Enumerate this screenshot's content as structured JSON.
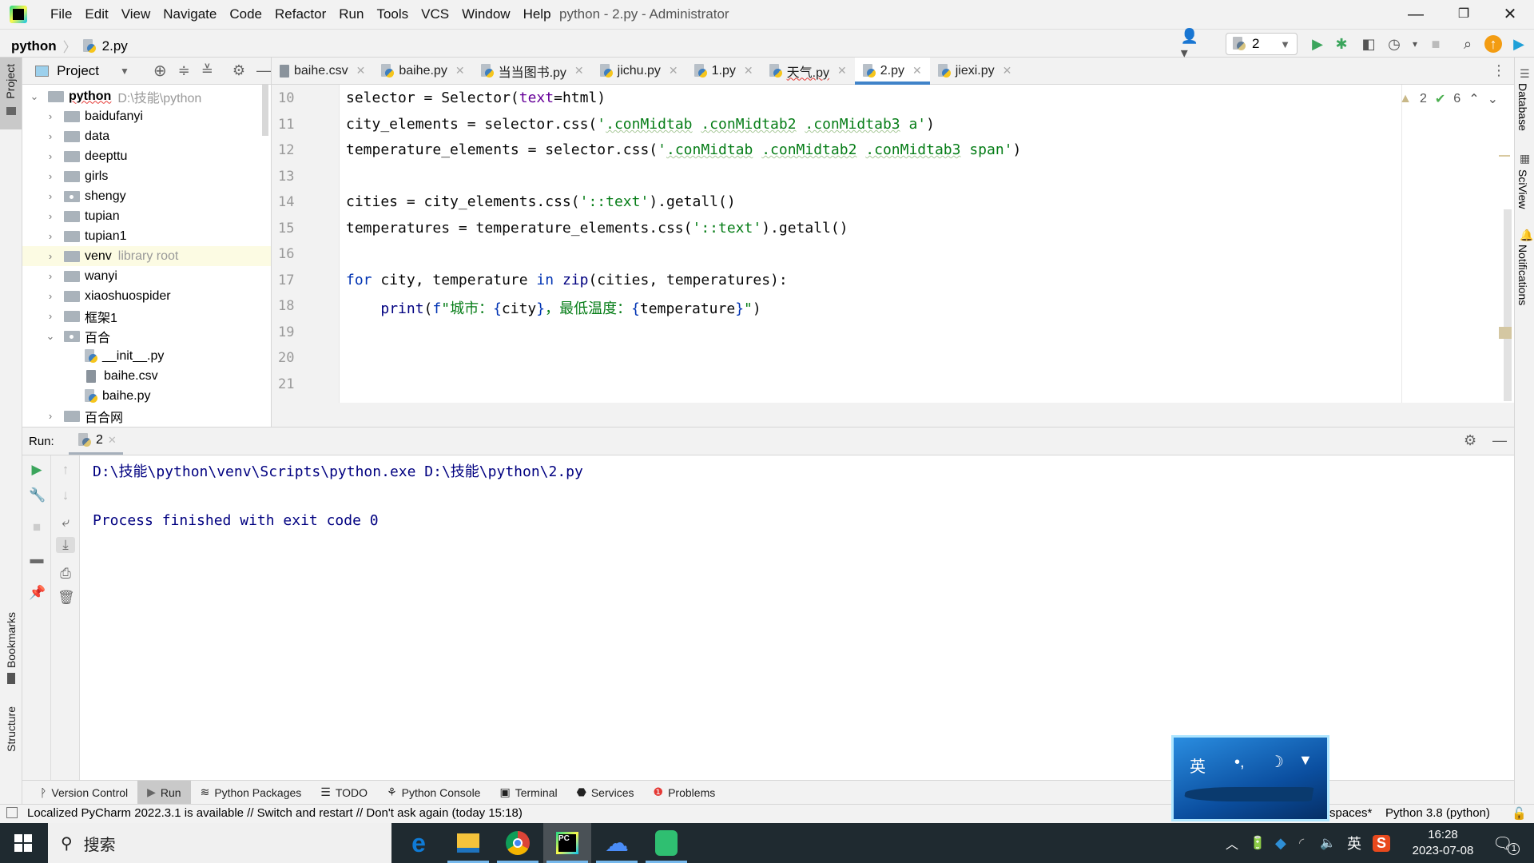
{
  "app": {
    "menus": [
      "File",
      "Edit",
      "View",
      "Navigate",
      "Code",
      "Refactor",
      "Run",
      "Tools",
      "VCS",
      "Window",
      "Help"
    ],
    "title": "python - 2.py - Administrator"
  },
  "breadcrumb": {
    "project": "python",
    "file": "2.py"
  },
  "run_config": {
    "name": "2"
  },
  "project_panel": {
    "title": "Project",
    "root": {
      "name": "python",
      "path": "D:\\技能\\python"
    },
    "items": [
      {
        "name": "baidufanyi",
        "type": "folder",
        "expanded": false
      },
      {
        "name": "data",
        "type": "folder",
        "expanded": false
      },
      {
        "name": "deepttu",
        "type": "folder",
        "expanded": false
      },
      {
        "name": "girls",
        "type": "folder",
        "expanded": false
      },
      {
        "name": "shengy",
        "type": "package",
        "expanded": false
      },
      {
        "name": "tupian",
        "type": "folder",
        "expanded": false
      },
      {
        "name": "tupian1",
        "type": "folder",
        "expanded": false
      },
      {
        "name": "venv",
        "type": "folder",
        "note": "library root",
        "expanded": false
      },
      {
        "name": "wanyi",
        "type": "folder",
        "expanded": false
      },
      {
        "name": "xiaoshuospider",
        "type": "folder",
        "expanded": false
      },
      {
        "name": "框架1",
        "type": "folder",
        "expanded": false
      },
      {
        "name": "百合",
        "type": "package",
        "expanded": true
      },
      {
        "name": "__init__.py",
        "type": "py"
      },
      {
        "name": "baihe.csv",
        "type": "csv"
      },
      {
        "name": "baihe.py",
        "type": "py"
      },
      {
        "name": "百合网",
        "type": "folder",
        "expanded": false
      }
    ]
  },
  "tabs": [
    {
      "label": "baihe.csv",
      "type": "csv"
    },
    {
      "label": "baihe.py",
      "type": "py"
    },
    {
      "label": "当当图书.py",
      "type": "py"
    },
    {
      "label": "jichu.py",
      "type": "py"
    },
    {
      "label": "1.py",
      "type": "py"
    },
    {
      "label": "天气.py",
      "type": "py",
      "error": true
    },
    {
      "label": "2.py",
      "type": "py",
      "active": true
    },
    {
      "label": "jiexi.py",
      "type": "py"
    }
  ],
  "inspections": {
    "warnings": "2",
    "weak_warnings": "6"
  },
  "editor": {
    "line_numbers": [
      "10",
      "11",
      "12",
      "13",
      "14",
      "15",
      "16",
      "17",
      "18",
      "19",
      "20",
      "21"
    ],
    "lines": [
      "selector = Selector(text=html)",
      "city_elements = selector.css('.conMidtab .conMidtab2 .conMidtab3 a')",
      "temperature_elements = selector.css('.conMidtab .conMidtab2 .conMidtab3 span')",
      "",
      "cities = city_elements.css('::text').getall()",
      "temperatures = temperature_elements.css('::text').getall()",
      "",
      "for city, temperature in zip(cities, temperatures):",
      "    print(f\"城市：{city}，最低温度：{temperature}\")",
      "",
      "",
      ""
    ]
  },
  "right_stripe": [
    "Database",
    "SciView",
    "Notifications"
  ],
  "left_stripe": [
    "Project",
    "Bookmarks",
    "Structure"
  ],
  "run_panel": {
    "label": "Run:",
    "tab": "2",
    "output": [
      "D:\\技能\\python\\venv\\Scripts\\python.exe D:\\技能\\python\\2.py",
      "",
      "Process finished with exit code 0"
    ]
  },
  "bottom_tools": [
    "Version Control",
    "Run",
    "Python Packages",
    "TODO",
    "Python Console",
    "Terminal",
    "Services",
    "Problems"
  ],
  "status": {
    "message": "Localized PyCharm 2022.3.1 is available // Switch and restart // Don't ask again (today 15:18)",
    "indent": "spaces*",
    "interpreter": "Python 3.8 (python)"
  },
  "ime_popup": {
    "mode": "英",
    "punct": "•,",
    "moon": "☽",
    "shirt": "👕"
  },
  "taskbar": {
    "search_placeholder": "搜索",
    "ime": "英",
    "time": "16:28",
    "date": "2023-07-08",
    "notifications": "1"
  }
}
